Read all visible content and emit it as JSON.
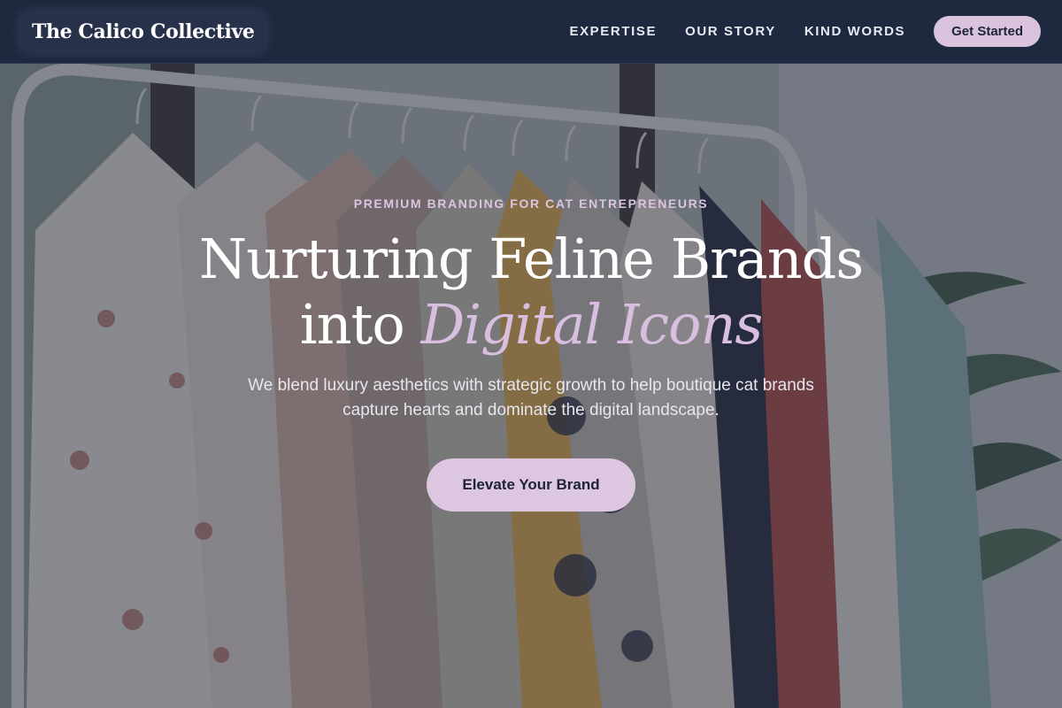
{
  "nav": {
    "brand": "The Calico Collective",
    "links": [
      "EXPERTISE",
      "OUR STORY",
      "KIND WORDS"
    ],
    "cta_label": "Get Started"
  },
  "hero": {
    "eyebrow": "PREMIUM BRANDING FOR CAT ENTREPRENEURS",
    "headline_line1": "Nurturing Feline Brands",
    "headline_line2_prefix": "into ",
    "headline_line2_accent": "Digital Icons",
    "subheadline": "We blend luxury aesthetics with strategic growth to help boutique cat brands capture hearts and dominate the digital landscape.",
    "cta_label": "Elevate Your Brand",
    "background_image": "clothes-rack-photo"
  },
  "colors": {
    "nav_bg": "#1e293f",
    "accent_lavender": "#d9c3dd",
    "headline_accent": "#d8bfe0",
    "text_white": "#ffffff"
  }
}
